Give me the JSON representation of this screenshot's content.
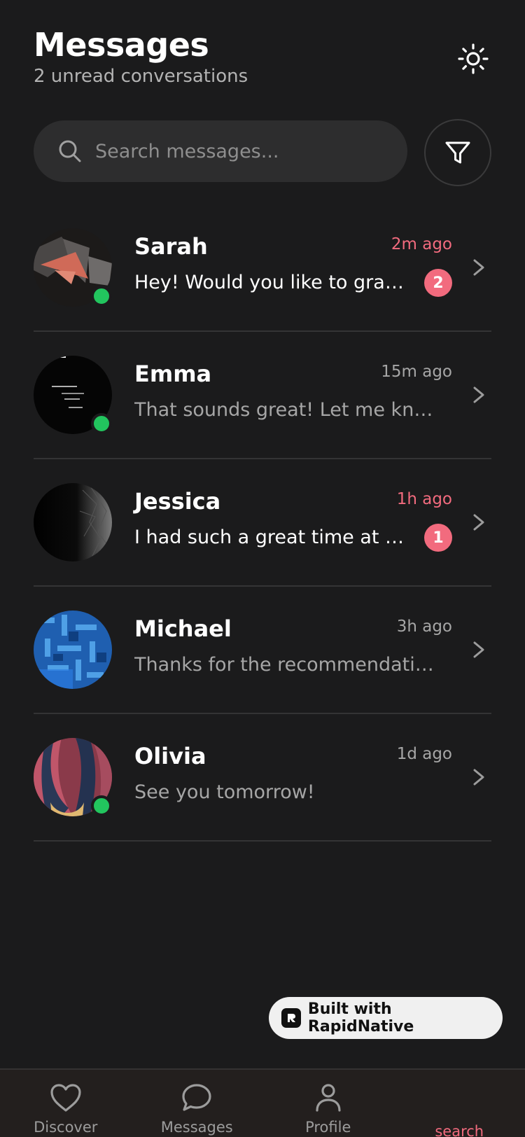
{
  "header": {
    "title": "Messages",
    "subtitle": "2 unread conversations"
  },
  "search": {
    "placeholder": "Search messages..."
  },
  "conversations": [
    {
      "name": "Sarah",
      "time": "2m ago",
      "preview": "Hey! Would you like to grab coffee this weekend?",
      "unread_count": "2",
      "online": true
    },
    {
      "name": "Emma",
      "time": "15m ago",
      "preview": "That sounds great! Let me know when you're free",
      "unread_count": null,
      "online": true
    },
    {
      "name": "Jessica",
      "time": "1h ago",
      "preview": "I had such a great time at the concert last night",
      "unread_count": "1",
      "online": false
    },
    {
      "name": "Michael",
      "time": "3h ago",
      "preview": "Thanks for the recommendation on that book",
      "unread_count": null,
      "online": false
    },
    {
      "name": "Olivia",
      "time": "1d ago",
      "preview": "See you tomorrow!",
      "unread_count": null,
      "online": true
    }
  ],
  "builder_badge": {
    "label": "Built with RapidNative"
  },
  "tabs": [
    {
      "label": "Discover",
      "icon": "heart-icon"
    },
    {
      "label": "Messages",
      "icon": "chat-bubble-icon"
    },
    {
      "label": "Profile",
      "icon": "user-icon"
    },
    {
      "label": "search",
      "icon": "search-icon"
    }
  ],
  "colors": {
    "background": "#1b1b1c",
    "accent": "#f26b7e",
    "online": "#22c55e",
    "muted_text": "#a6a6a6"
  }
}
